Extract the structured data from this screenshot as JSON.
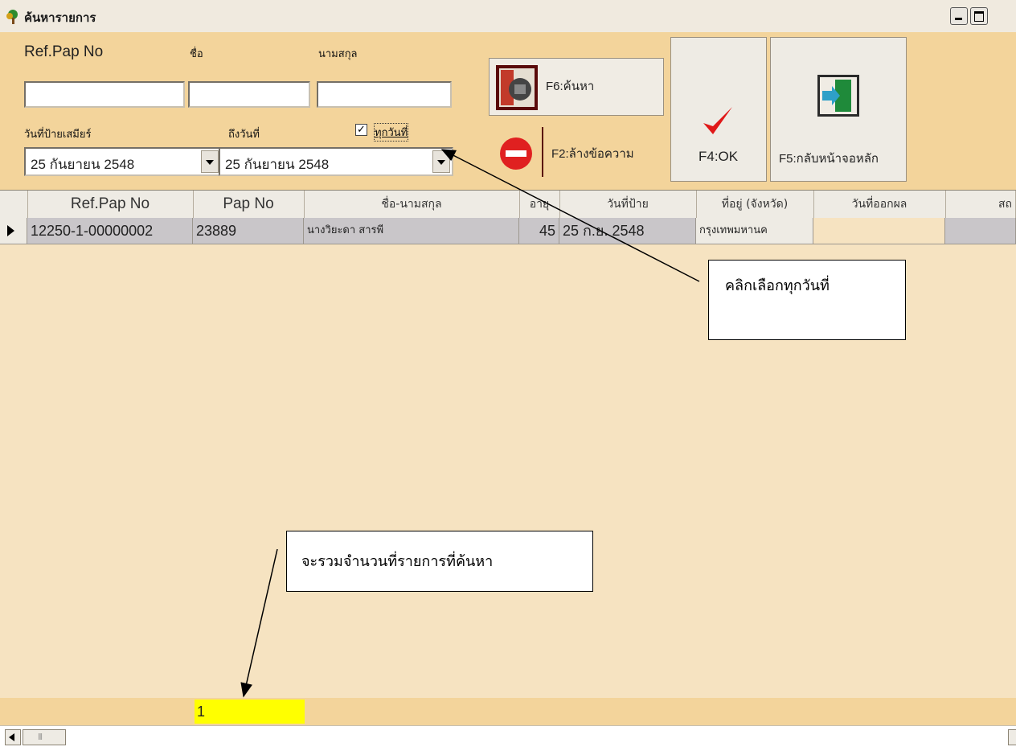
{
  "window": {
    "title": "ค้นหารายการ",
    "controls": [
      "minimize-icon",
      "maximize-icon"
    ]
  },
  "search": {
    "ref_label": "Ref.Pap No",
    "name_label": "ชื่อ",
    "surname_label": "นามสกุล",
    "ref_value": "",
    "name_value": "",
    "surname_value": "",
    "date_label": "วันที่ป้ายเสมียร์",
    "to_date_label": "ถึงวันที่",
    "all_dates_label": "ทุกวันที่",
    "all_dates_checked": true,
    "from_date": "25  กันยายน    2548",
    "to_date": "25  กันยายน    2548"
  },
  "buttons": {
    "search": "F6:ค้นหา",
    "clear": "F2:ล้างข้อความ",
    "ok": "F4:OK",
    "back": "F5:กลับหน้าจอหลัก"
  },
  "grid": {
    "columns": [
      "Ref.Pap No",
      "Pap No",
      "ชื่อ-นามสกุล",
      "อายุ",
      "วันที่ป้าย",
      "ที่อยู่ (จังหวัด)",
      "วันที่ออกผล",
      "สถ"
    ],
    "rows": [
      {
        "ref": "12250-1-00000002",
        "pap": "23889",
        "name": "นางวิยะดา สารพี",
        "age": "45",
        "date": "25 ก.ย. 2548",
        "address": "กรุงเทพมหานค",
        "result_date": "",
        "status": ""
      }
    ]
  },
  "annotations": {
    "select_all_dates": "คลิกเลือกทุกวันที่",
    "count_note": "จะรวมจำนวนที่รายการที่ค้นหา"
  },
  "footer": {
    "count": "1"
  },
  "colors": {
    "toolbar": "#f3d49b",
    "body": "#f6e3c1",
    "selected_row": "#c9c6c9",
    "count_box": "#ffff00"
  }
}
